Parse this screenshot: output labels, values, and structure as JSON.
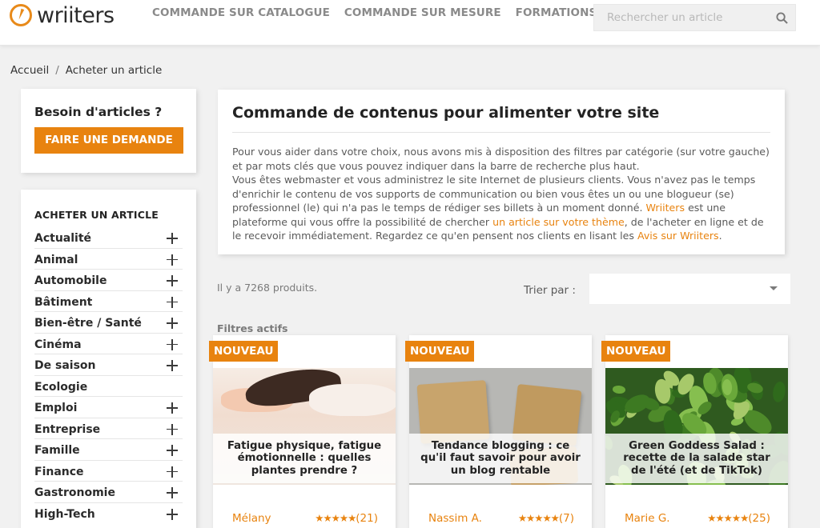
{
  "header": {
    "logo_text": "wriiters",
    "nav": [
      "COMMANDE SUR CATALOGUE",
      "COMMANDE SUR MESURE",
      "FORMATIONS"
    ],
    "search_placeholder": "Rechercher un article"
  },
  "breadcrumb": {
    "home": "Accueil",
    "separator": "/",
    "current": "Acheter un article"
  },
  "sidebar": {
    "need_title": "Besoin d'articles ?",
    "request_button": "FAIRE UNE DEMANDE",
    "categories_heading": "ACHETER UN ARTICLE",
    "categories": [
      {
        "label": "Actualité",
        "expandable": true
      },
      {
        "label": "Animal",
        "expandable": true
      },
      {
        "label": "Automobile",
        "expandable": true
      },
      {
        "label": "Bâtiment",
        "expandable": true
      },
      {
        "label": "Bien-être / Santé",
        "expandable": true
      },
      {
        "label": "Cinéma",
        "expandable": true
      },
      {
        "label": "De saison",
        "expandable": true
      },
      {
        "label": "Ecologie",
        "expandable": false
      },
      {
        "label": "Emploi",
        "expandable": true
      },
      {
        "label": "Entreprise",
        "expandable": true
      },
      {
        "label": "Famille",
        "expandable": true
      },
      {
        "label": "Finance",
        "expandable": true
      },
      {
        "label": "Gastronomie",
        "expandable": true
      },
      {
        "label": "High-Tech",
        "expandable": true
      }
    ]
  },
  "intro": {
    "title": "Commande de contenus pour alimenter votre site",
    "p1": "Pour vous aider dans votre choix, nous avons mis à disposition des filtres par catégorie (sur votre gauche) et par mots clés que vous pouvez indiquer dans la barre de recherche plus haut.",
    "p2_a": "Vous êtes webmaster et vous administrez le site Internet de plusieurs clients. Vous n'avez pas le temps d'enrichir le contenu de vos supports de communication ou bien vous êtes un ou une blogueur (se) professionnel (le) qui n'a pas le temps de rédiger ses billets à un moment donné.",
    "link_wriiters": "Wriiters",
    "p2_b": "est une plateforme qui vous offre la possibilité de chercher",
    "link_article": "un article sur votre thème",
    "p2_c": ", de l'acheter en ligne et de le recevoir immédiatement. Regardez ce qu'en pensent nos clients en lisant les",
    "link_avis": "Avis sur Wriiters",
    "p2_end": "."
  },
  "listing": {
    "count": "Il y a 7268 produits.",
    "sort_label": "Trier par :",
    "sort_value": "",
    "filters_label": "Filtres actifs"
  },
  "products": [
    {
      "badge": "NOUVEAU",
      "title": "Fatigue physique, fatigue émotionnelle : quelles plantes prendre ?",
      "author": "Mélany",
      "stars": "★★★★★",
      "reviews": "(21)"
    },
    {
      "badge": "NOUVEAU",
      "title": "Tendance blogging : ce qu'il faut savoir pour avoir un blog rentable",
      "author": "Nassim A.",
      "stars": "★★★★★",
      "reviews": "(7)"
    },
    {
      "badge": "NOUVEAU",
      "title": "Green Goddess Salad : recette de la salade star de l'été (et de TikTok)",
      "author": "Marie G.",
      "stars": "★★★★★",
      "reviews": "(25)"
    }
  ],
  "colors": {
    "accent": "#e8830f",
    "nav": "#8a8a8a",
    "background": "#f1f1f1"
  }
}
